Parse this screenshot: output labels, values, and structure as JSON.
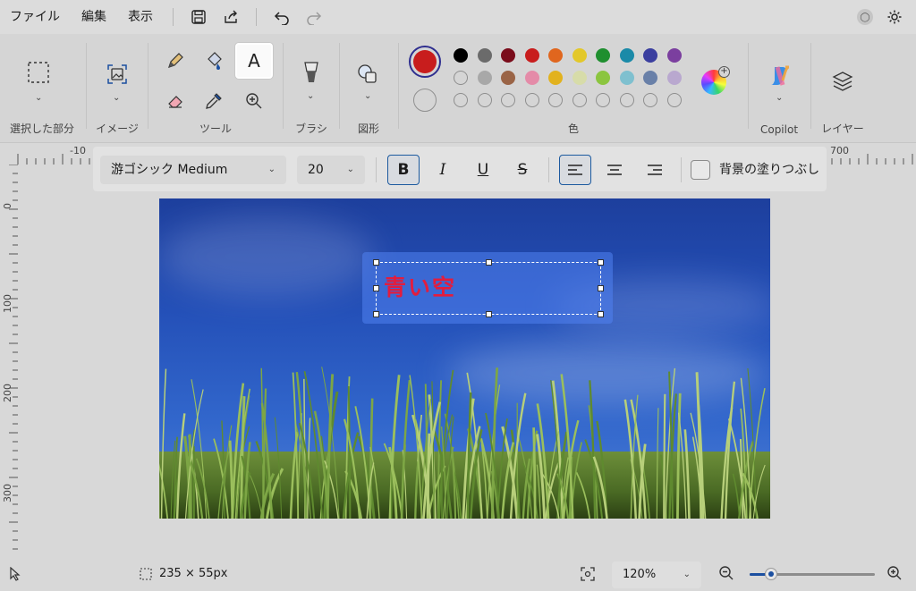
{
  "menu": {
    "items": [
      "ファイル",
      "編集",
      "表示"
    ]
  },
  "ribbon": {
    "groups": {
      "selection": "選択した部分",
      "image": "イメージ",
      "tools": "ツール",
      "brushes": "ブラシ",
      "shapes": "図形",
      "colors": "色",
      "copilot": "Copilot",
      "layers": "レイヤー"
    },
    "primary_color": "#c81d1d",
    "palette_row1": [
      "#000000",
      "#6b6b6b",
      "#7a0c1b",
      "#c81d1d",
      "#e0661e",
      "#e3c82a",
      "#1f8f2f",
      "#1b8aa8",
      "#3b3f9f",
      "#7b3f9f"
    ],
    "palette_row2": [
      "",
      "#a8a8a8",
      "#9a6446",
      "#e48ba8",
      "#e2b21e",
      "#d7dca9",
      "#8bc53f",
      "#7fc0cf",
      "#6980a8",
      "#b9a8cf"
    ]
  },
  "ruler": {
    "top": [
      "-10",
      "700"
    ],
    "left": [
      "0",
      "100",
      "200",
      "300"
    ]
  },
  "textbar": {
    "font": "游ゴシック Medium",
    "size": "20",
    "bold": "B",
    "italic": "I",
    "underline": "U",
    "strike": "S",
    "background_fill_label": "背景の塗りつぶし"
  },
  "canvas": {
    "text": "青い空",
    "text_color": "#e21d3e"
  },
  "status": {
    "selection_size": "235 × 55px",
    "zoom": "120%",
    "zoom_level": 0.17
  }
}
